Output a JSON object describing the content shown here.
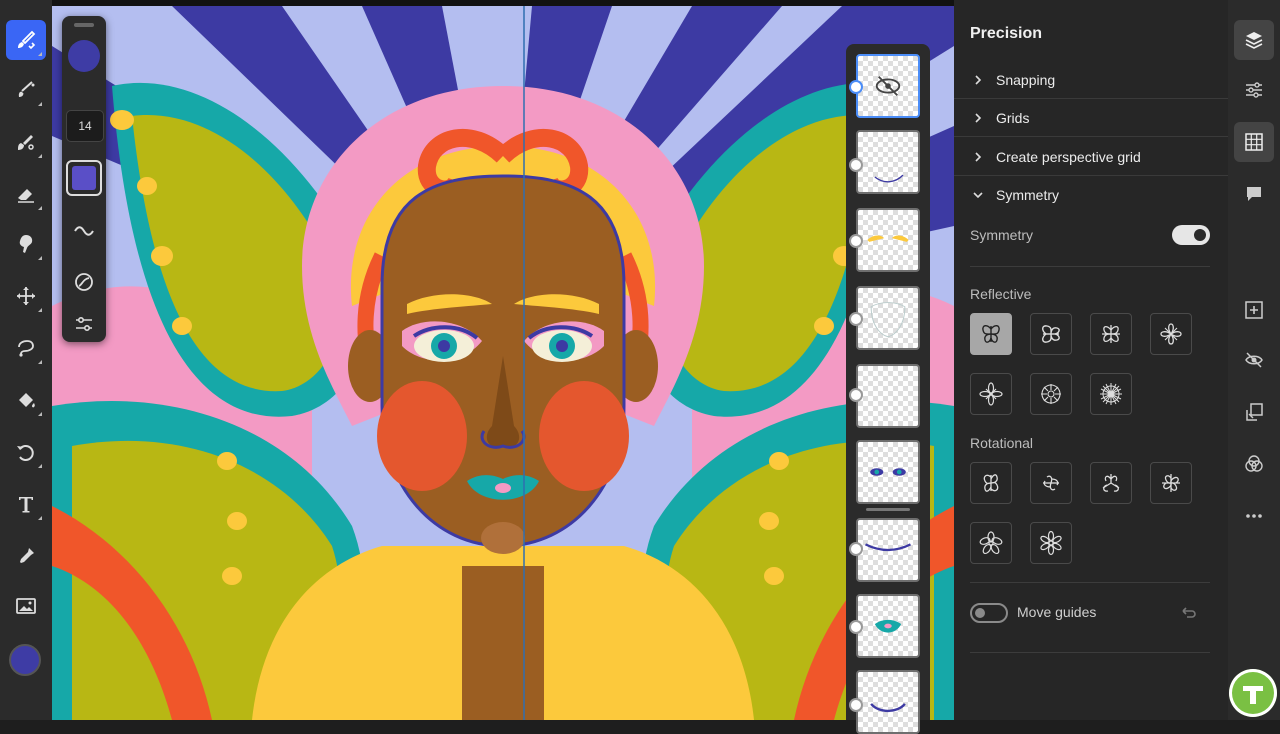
{
  "tools": {
    "items": [
      {
        "name": "pixel-brush-tool",
        "active": true
      },
      {
        "name": "live-brush-tool"
      },
      {
        "name": "mixer-brush-tool"
      },
      {
        "name": "eraser-tool"
      },
      {
        "name": "smudge-tool"
      },
      {
        "name": "transform-tool"
      },
      {
        "name": "lasso-tool"
      },
      {
        "name": "fill-tool"
      },
      {
        "name": "liquify-tool"
      },
      {
        "name": "text-tool"
      },
      {
        "name": "eyedropper-tool"
      },
      {
        "name": "place-image-tool"
      }
    ],
    "current_color": "#3e3ca5"
  },
  "tool_options": {
    "brush_color": "#3e3ca5",
    "size_value": "14",
    "secondary_color": "#5a4fc7"
  },
  "layers": {
    "count_visible": 9,
    "selected_index": 0
  },
  "precision": {
    "title": "Precision",
    "sections": [
      {
        "label": "Snapping",
        "expanded": false
      },
      {
        "label": "Grids",
        "expanded": false
      },
      {
        "label": "Create perspective grid",
        "expanded": false
      },
      {
        "label": "Symmetry",
        "expanded": true
      }
    ],
    "symmetry": {
      "toggle_label": "Symmetry",
      "enabled": true,
      "reflective_label": "Reflective",
      "rotational_label": "Rotational",
      "move_guides_label": "Move guides",
      "move_guides_enabled": false,
      "selected_mode": "reflective-vertical"
    }
  },
  "right_rail": {
    "items": [
      "layers",
      "adjustments",
      "precision",
      "comments",
      "add-layer",
      "hide-layer",
      "layer-mask",
      "blend-modes",
      "more-options"
    ],
    "active": "precision"
  },
  "colors": {
    "accent": "#3a66f5",
    "panel_bg": "#262626",
    "toolbar_bg": "#2b2b2b"
  }
}
